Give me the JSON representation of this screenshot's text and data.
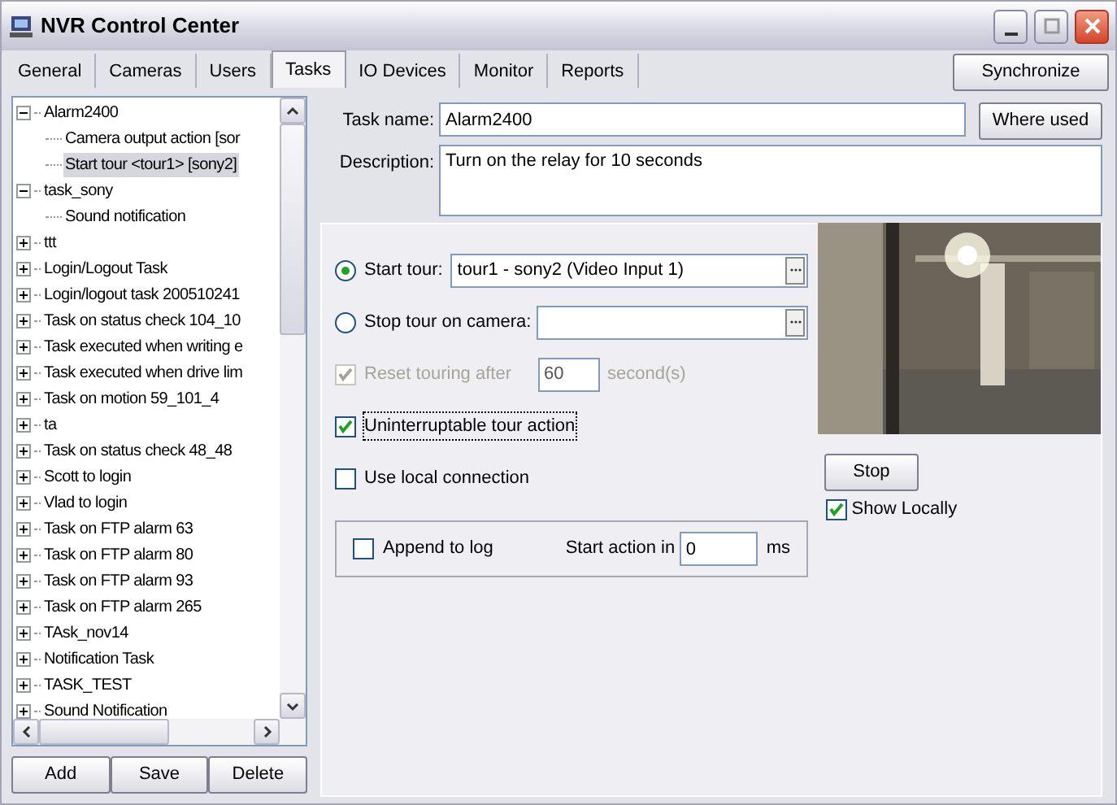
{
  "window": {
    "title": "NVR Control Center"
  },
  "tabs": [
    {
      "label": "General",
      "selected": false
    },
    {
      "label": "Cameras",
      "selected": false
    },
    {
      "label": "Users",
      "selected": false
    },
    {
      "label": "Tasks",
      "selected": true
    },
    {
      "label": "IO Devices",
      "selected": false
    },
    {
      "label": "Monitor",
      "selected": false
    },
    {
      "label": "Reports",
      "selected": false
    }
  ],
  "sync_button": "Synchronize",
  "tree": {
    "items": [
      {
        "label": "Alarm2400",
        "expanded": true,
        "selected": false,
        "children": [
          {
            "label": "Camera output action [sor",
            "selected": false
          },
          {
            "label": "Start tour <tour1> [sony2]",
            "selected": true
          }
        ]
      },
      {
        "label": "task_sony",
        "expanded": true,
        "selected": false,
        "children": [
          {
            "label": "Sound notification",
            "selected": false
          }
        ]
      },
      {
        "label": "ttt",
        "expanded": false,
        "selected": false
      },
      {
        "label": "Login/Logout Task",
        "expanded": false,
        "selected": false
      },
      {
        "label": "Login/logout task 200510241",
        "expanded": false,
        "selected": false
      },
      {
        "label": "Task on status check 104_10",
        "expanded": false,
        "selected": false
      },
      {
        "label": "Task executed when writing e",
        "expanded": false,
        "selected": false
      },
      {
        "label": "Task executed when drive lim",
        "expanded": false,
        "selected": false
      },
      {
        "label": "Task on motion 59_101_4",
        "expanded": false,
        "selected": false
      },
      {
        "label": "ta",
        "expanded": false,
        "selected": false
      },
      {
        "label": "Task on status check 48_48",
        "expanded": false,
        "selected": false
      },
      {
        "label": "Scott to login",
        "expanded": false,
        "selected": false
      },
      {
        "label": "Vlad to login",
        "expanded": false,
        "selected": false
      },
      {
        "label": "Task on FTP alarm 63",
        "expanded": false,
        "selected": false
      },
      {
        "label": "Task on FTP alarm 80",
        "expanded": false,
        "selected": false
      },
      {
        "label": "Task on FTP alarm 93",
        "expanded": false,
        "selected": false
      },
      {
        "label": "Task on FTP alarm 265",
        "expanded": false,
        "selected": false
      },
      {
        "label": "TAsk_nov14",
        "expanded": false,
        "selected": false
      },
      {
        "label": "Notification Task",
        "expanded": false,
        "selected": false
      },
      {
        "label": "TASK_TEST",
        "expanded": false,
        "selected": false
      },
      {
        "label": "Sound Notification",
        "expanded": false,
        "selected": false
      }
    ]
  },
  "tree_buttons": [
    "Add",
    "Save",
    "Delete"
  ],
  "task_name": {
    "label": "Task name:",
    "value": "Alarm2400"
  },
  "where_used_button": "Where used",
  "description": {
    "label": "Description:",
    "value": "Turn on the relay for 10 seconds"
  },
  "tour_options": [
    {
      "label": "Start tour:",
      "selected": true,
      "value": "tour1 - sony2 (Video Input 1)"
    },
    {
      "label": "Stop tour on camera:",
      "selected": false
    }
  ],
  "reset_touring": {
    "label": "Reset touring after",
    "checked": true,
    "disabled": true,
    "value": "60",
    "unit": "second(s)"
  },
  "uninterruptable": {
    "label": "Uninterruptable tour action",
    "checked": true
  },
  "local_connection": {
    "label": "Use local connection",
    "checked": false
  },
  "log": {
    "label": "Append to log",
    "checked": false,
    "delay_label": "Start action in",
    "delay_value": "0",
    "delay_unit": "ms"
  },
  "preview": {
    "kind": "picture",
    "stop_button": "Stop",
    "show_locally": {
      "label": "Show Locally",
      "checked": true
    }
  }
}
